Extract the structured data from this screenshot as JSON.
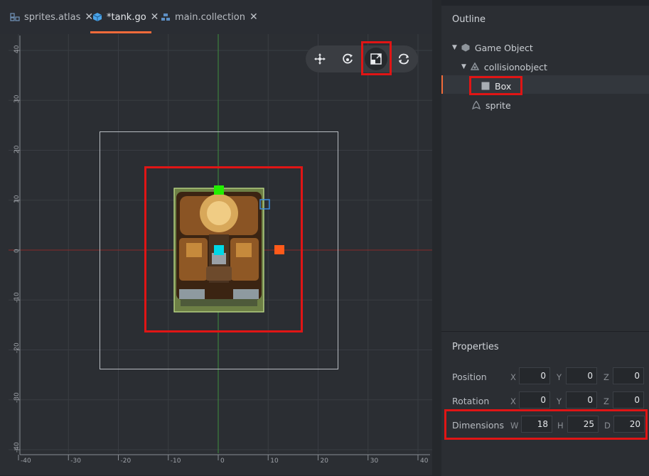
{
  "tabs": [
    {
      "label": "sprites.atlas",
      "icon": "atlas-icon"
    },
    {
      "label": "*tank.go",
      "icon": "game-object-icon",
      "active": true
    },
    {
      "label": "main.collection",
      "icon": "collection-icon"
    }
  ],
  "tab_close_glyph": "✕",
  "rulers": {
    "vertical": [
      "40",
      "30",
      "20",
      "10",
      "0",
      "-10",
      "-20",
      "-30",
      "-40"
    ],
    "horizontal": [
      "-40",
      "-30",
      "-20",
      "-10",
      "0",
      "10",
      "20",
      "30",
      "40"
    ]
  },
  "toolbar": {
    "tools": [
      {
        "name": "move-tool",
        "icon": "move-icon"
      },
      {
        "name": "rotate-tool",
        "icon": "rotate-icon"
      },
      {
        "name": "scale-tool",
        "icon": "scale-icon",
        "active": true
      },
      {
        "name": "camera-tool",
        "icon": "camera-reset-icon"
      }
    ]
  },
  "outline": {
    "title": "Outline",
    "nodes": [
      {
        "label": "Game Object",
        "icon": "game-object-icon",
        "expanded": true
      },
      {
        "label": "collisionobject",
        "icon": "collision-object-icon",
        "expanded": true
      },
      {
        "label": "Box",
        "icon": "box-shape-icon",
        "selected": true
      },
      {
        "label": "sprite",
        "icon": "sprite-icon"
      }
    ]
  },
  "properties": {
    "title": "Properties",
    "position": {
      "label": "Position",
      "x_axis": "X",
      "x": "0",
      "y_axis": "Y",
      "y": "0",
      "z_axis": "Z",
      "z": "0"
    },
    "rotation": {
      "label": "Rotation",
      "x_axis": "X",
      "x": "0",
      "y_axis": "Y",
      "y": "0",
      "z_axis": "Z",
      "z": "0"
    },
    "dimensions": {
      "label": "Dimensions",
      "w_axis": "W",
      "w": "18",
      "h_axis": "H",
      "h": "25",
      "d_axis": "D",
      "d": "20"
    }
  },
  "colors": {
    "accent": "#f26b3a",
    "highlight": "#e01515",
    "handle_green": "#22ee00",
    "handle_orange": "#ff5a1a",
    "handle_cyan": "#00d8e6"
  }
}
